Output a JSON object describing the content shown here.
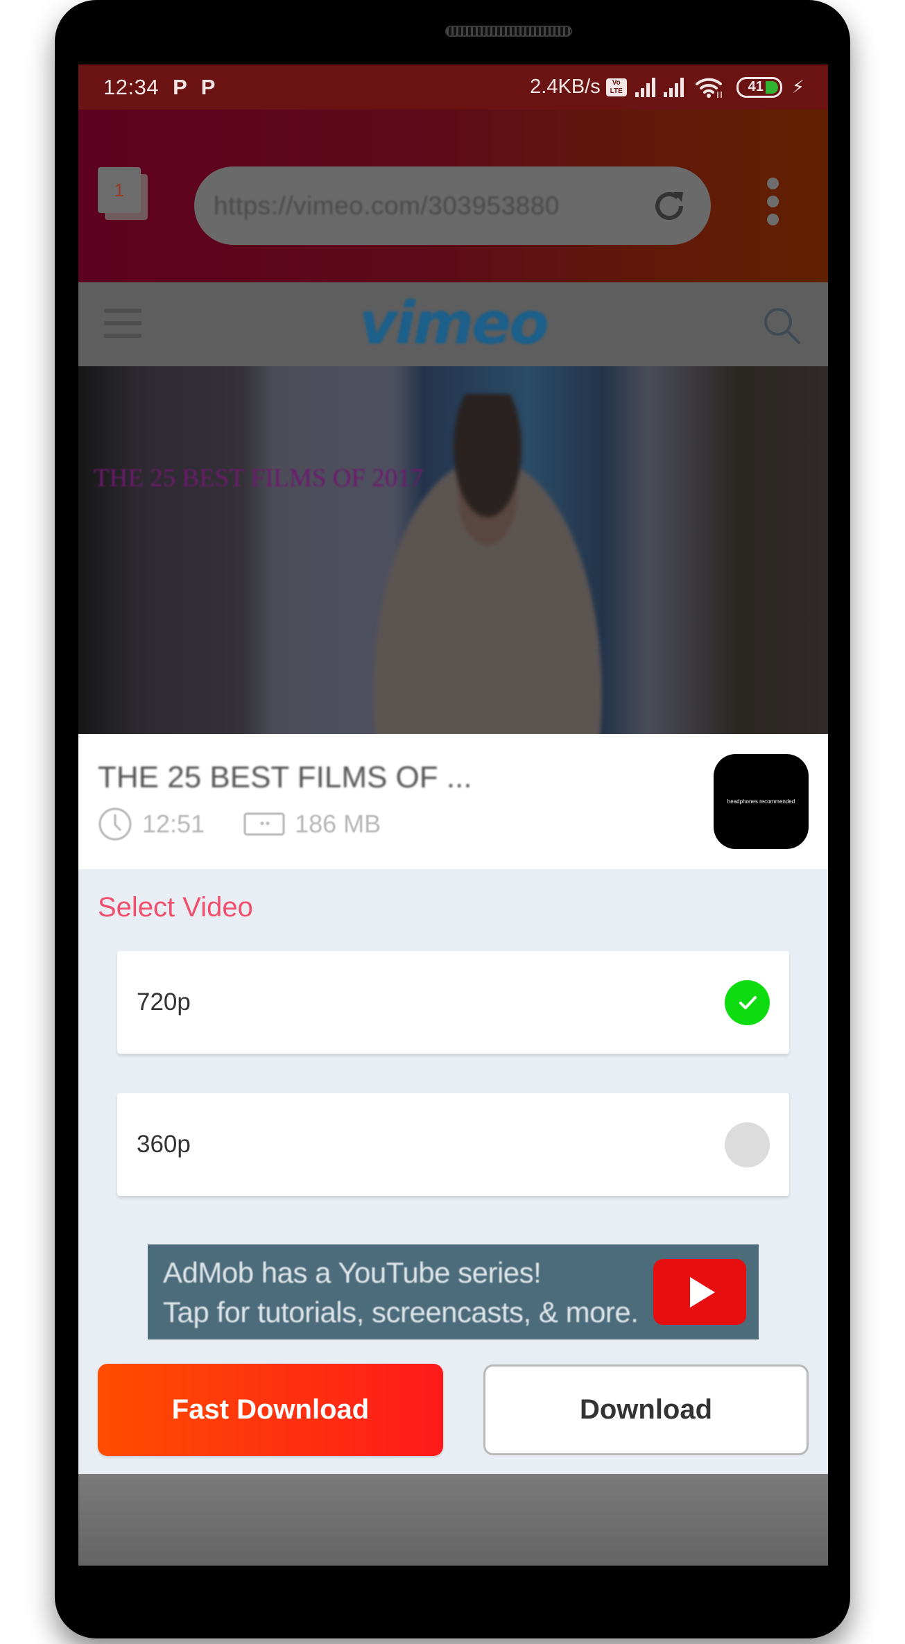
{
  "status_bar": {
    "time": "12:34",
    "notification_icons": [
      "P",
      "P"
    ],
    "network_speed": "2.4KB/s",
    "volte_badge": [
      "Vo",
      "LTE"
    ],
    "battery_level": "41",
    "battery_percent": 41,
    "charging": true
  },
  "browser": {
    "tab_count": "1",
    "url": "https://vimeo.com/303953880",
    "icons": {
      "reload": "reload-icon",
      "menu": "more-vert-icon"
    }
  },
  "site": {
    "logo": "vimeo",
    "icons": {
      "menu": "hamburger-icon",
      "search": "search-icon"
    }
  },
  "video": {
    "overlay_text": "THE 25 BEST FILMS OF 2017"
  },
  "info": {
    "title": "THE 25 BEST FILMS OF ...",
    "duration": "12:51",
    "size": "186 MB",
    "thumbnail_text": "headphones recommended"
  },
  "select": {
    "label": "Select Video",
    "options": [
      {
        "label": "720p",
        "selected": true
      },
      {
        "label": "360p",
        "selected": false
      }
    ],
    "selected_color": "#0fdc10",
    "label_color": "#f0506e"
  },
  "ad": {
    "line1": "AdMob has a YouTube series!",
    "line2": "Tap for tutorials, screencasts, & more."
  },
  "actions": {
    "fast_download": "Fast Download",
    "download": "Download"
  }
}
